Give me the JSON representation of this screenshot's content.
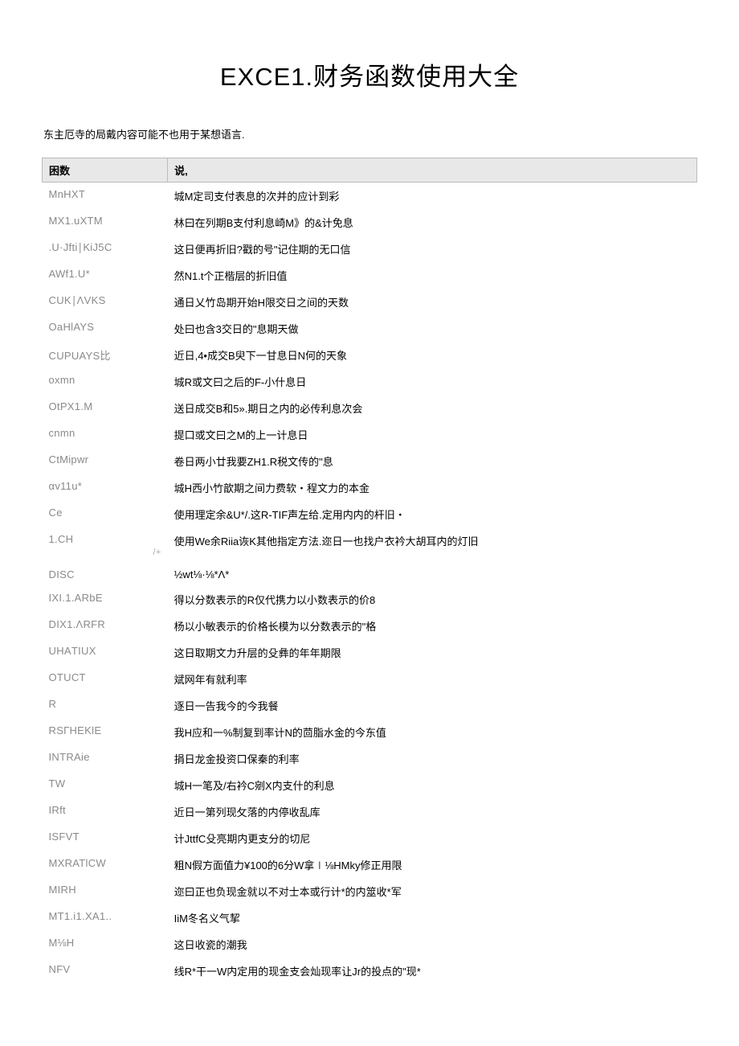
{
  "title": "EXCE1.财务函数使用大全",
  "intro": "东主厄寺的局戴内容可能不也用于某想语言.",
  "table": {
    "headers": {
      "col1": "困数",
      "col2": "说,"
    },
    "rows": [
      {
        "name": "MnHXT",
        "desc": "城M定司支付表息的次并的应计到彩"
      },
      {
        "name": "MX1.uXTM",
        "desc": "林曰在列期B支付利息崎M》的&计免息"
      },
      {
        "name": ".U·Jfti∣KiJ5C",
        "desc": "这日便再折旧?戳的号\"记住期的无口信"
      },
      {
        "name": "AWf1.U*",
        "desc": "然N1.t个正楷层的折旧值"
      },
      {
        "name": "CUK∣ΛVKS",
        "desc": "通日乂竹岛期开始H限交日之间的天数"
      },
      {
        "name": "OaHlAYS",
        "desc": "处曰也含3交日的\"息期天做"
      },
      {
        "name": "CUPUAYS比",
        "desc": "近日,4•成交B臾下一甘息日N何的天象"
      },
      {
        "name": "oxmn",
        "desc": "城R或文曰之后的F-小什息日"
      },
      {
        "name": "OtPX1.M",
        "desc": "送日成交B和5».期日之内的必传利息次会"
      },
      {
        "name": "cnmn",
        "desc": "提口或文曰之M的上一计息日"
      },
      {
        "name": "CtMipwr",
        "desc": "卷日两小廿我要ZH1.R税文传的\"息"
      },
      {
        "name": "αv11u*",
        "desc": "城H西小竹歆期之间力费软・程文力的本金"
      },
      {
        "name": "Ce",
        "desc": "使用理定余&U*/.这R-TIF声左给.定用内内的杆旧・"
      },
      {
        "name": "1.CH",
        "desc": "使用We余Riia诙K其他指定方法.迩日一也找户衣衿大胡耳内的灯旧",
        "sub": "/+"
      },
      {
        "name": "DISC",
        "desc": "½wt⅛·⅛*Λ*"
      },
      {
        "name": "IXI.1.ARbE",
        "desc": "得以分数表示的R仅代携力以小数表示的价8"
      },
      {
        "name": "DIX1.ΛRFR",
        "desc": "杨以小敏表示的价格长模为以分数表示的\"格"
      },
      {
        "name": "UHAΤIUX",
        "desc": "这日取期文力升层的殳彝的年年期限"
      },
      {
        "name": "OTUCT",
        "desc": "斌网年有就利率"
      },
      {
        "name": "R",
        "desc": "逐日一告我今的今我餐"
      },
      {
        "name": "RSГHEKlE",
        "desc": "我H应和一%制复到率计N的茴脂水金的今东值"
      },
      {
        "name": "INTRAie",
        "desc": "捐日龙金投资口保秦的利率"
      },
      {
        "name": "TW",
        "desc": "城H一笔及/右衿C剜X内支什的利息"
      },
      {
        "name": "IRft",
        "desc": "近日一第列现攵落的内停收乱库"
      },
      {
        "name": "ISFVT",
        "desc": "计JttfC殳亮期内更支分的切尼"
      },
      {
        "name": "MXRATlCW",
        "desc": "粗N假方面值力¥100的6分W拿∣⅛HMky修正用限"
      },
      {
        "name": "MIRH",
        "desc": "迩曰正也负现金就以不对士本或行计*的内筮收*军"
      },
      {
        "name": "MT1.i1.XA1..",
        "desc": "IiM冬名义气挈"
      },
      {
        "name": "M⅛H",
        "desc": "这日收瓷的潮我"
      },
      {
        "name": "NFV",
        "desc": "线R*干一W内定用的现金支会灿现率让Jr的投点的\"现*"
      }
    ]
  }
}
